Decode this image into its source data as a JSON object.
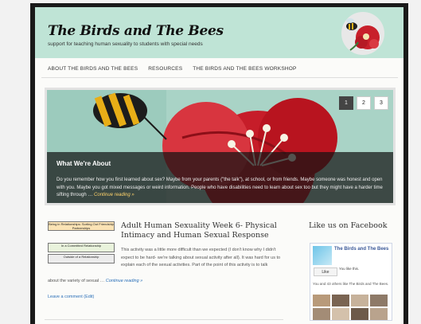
{
  "site": {
    "title": "The Birds and The Bees",
    "tagline": "support for teaching human sexuality to students with special needs"
  },
  "nav": [
    "ABOUT THE BIRDS AND THE BEES",
    "RESOURCES",
    "THE BIRDS AND THE BEES WORKSHOP"
  ],
  "slider": {
    "pages": [
      "1",
      "2",
      "3"
    ],
    "active_page": "1",
    "caption_title": "What We're About",
    "caption_text": "Do you remember how you first learned about sex? Maybe from your parents (\"the talk\"), at school, or from friends. Maybe someone was honest and open with you. Maybe you got mixed messages or weird information. People who have disabilities need to learn about sex too but they might have a harder time sifting through …",
    "caption_link": "Continue reading »"
  },
  "post": {
    "thumb_labels": [
      "Being in Relationships: Sorting Out Friendship Partnerships",
      "In a Committed Relationship",
      "Outside of a Relationship"
    ],
    "title": "Adult Human Sexuality Week 6- Physical Intimacy and Human Sexual Response",
    "excerpt": "This activity was a little more difficult than we expected (I don't know why I didn't expect to be hard- we're talking about sexual activity after all). It was hard for us to explain each of the sexual activities. Part of the point of this activity is to talk",
    "excerpt_end": "about the variety of sexual …",
    "read_more": "Continue reading »",
    "comment_link": "Leave a comment (Edit)"
  },
  "sidebar": {
    "facebook_heading": "Like us on Facebook",
    "page_name": "The Birds and The Bees",
    "like_label": "Like",
    "you_like": "You like this.",
    "others_text": "You and 43 others like The Birds and The Bees."
  },
  "colors": {
    "header_bg": "#bfe4d6",
    "link": "#2a6fb8",
    "facebook_blue": "#3b5998"
  },
  "icons": [
    "bee-flower-logo-icon",
    "facebook-page-icon"
  ]
}
